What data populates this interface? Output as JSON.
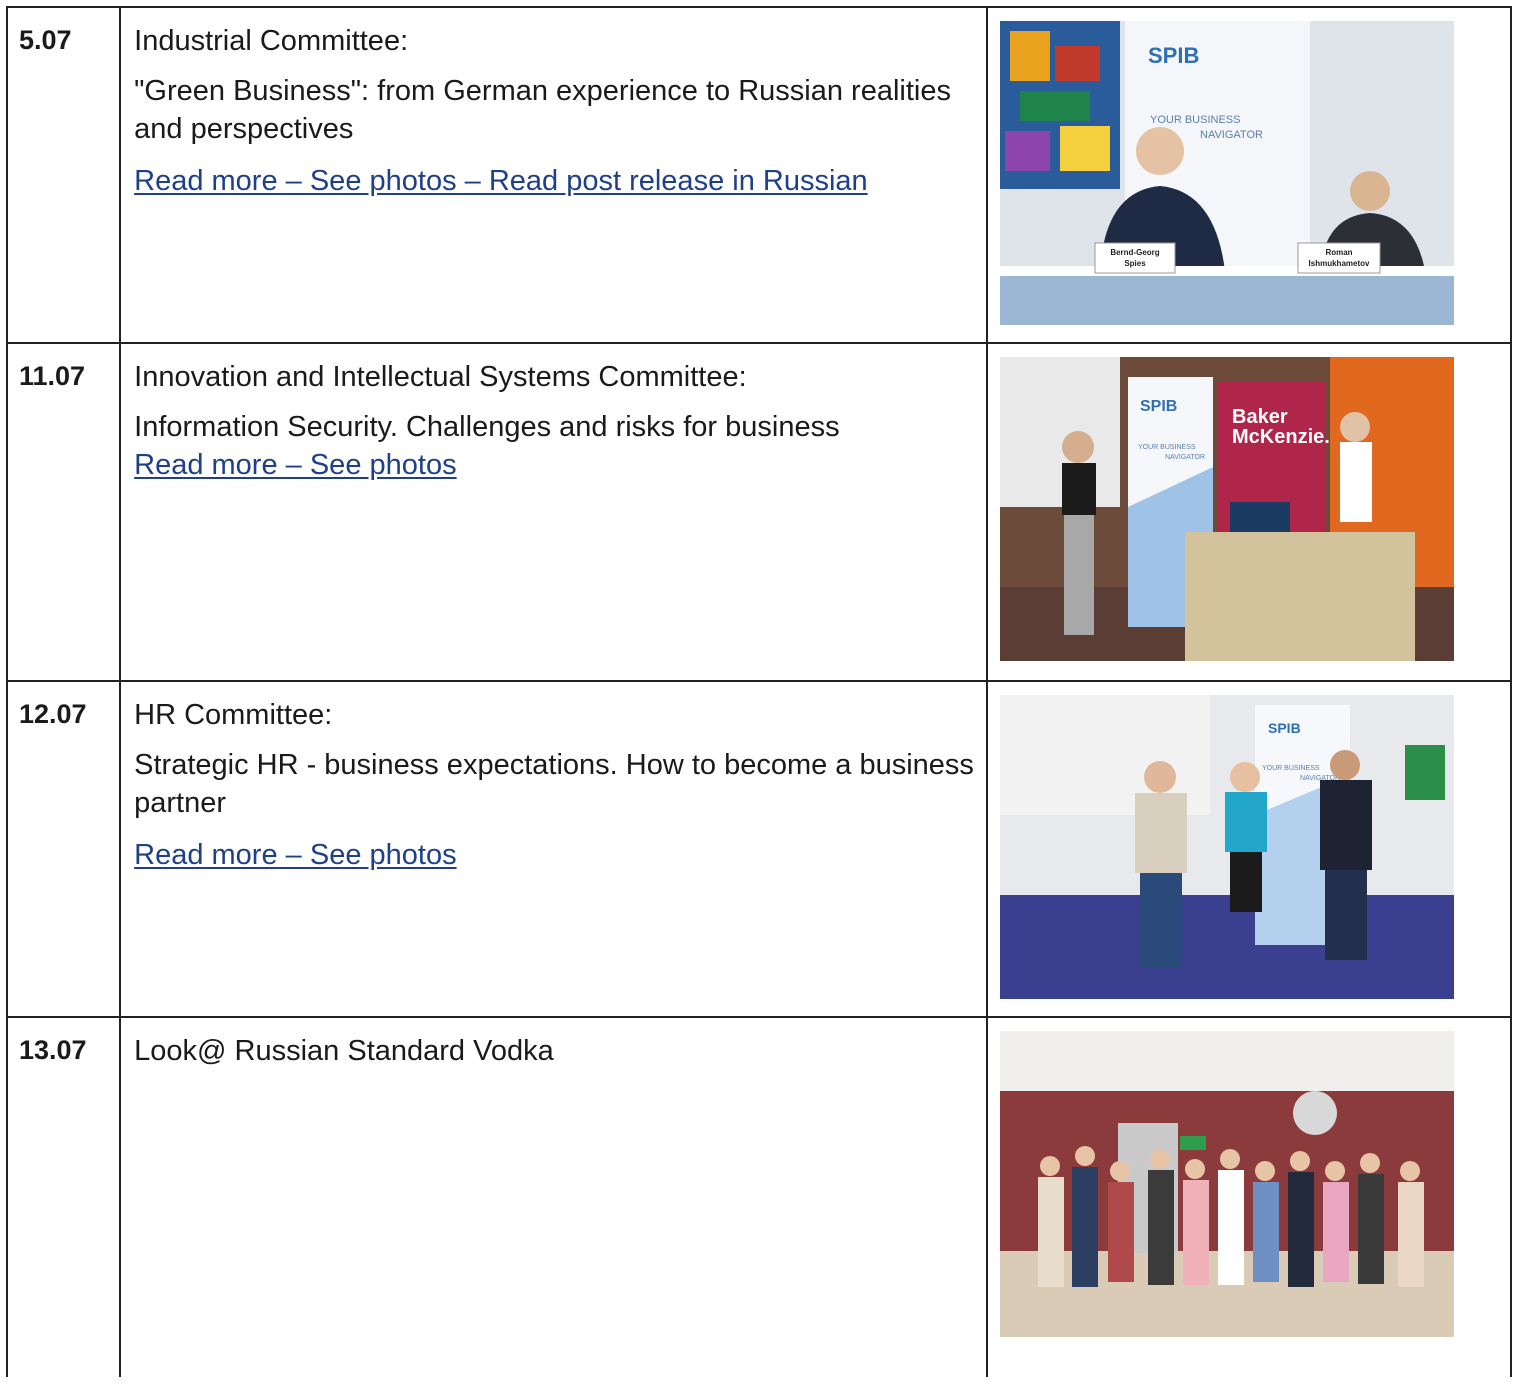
{
  "rows": [
    {
      "date": "5.07",
      "committee": "Industrial Committee:",
      "topic": "\"Green Business\": from German experience to Russian realities and perspectives",
      "links": [
        "Read more ",
        " – See photos",
        " – Read post release in Russian"
      ],
      "photo": {
        "banner_brand": "SPIB",
        "banner_line1": "YOUR BUSINESS",
        "banner_line2": "NAVIGATOR",
        "nameplate1_line1": "Bernd-Georg",
        "nameplate1_line2": "Spies",
        "nameplate2_line1": "Roman",
        "nameplate2_line2": "Ishmukhametov"
      }
    },
    {
      "date": "11.07",
      "committee": "Innovation and Intellectual Systems Committee:",
      "topic": "Information Security. Challenges and risks for business",
      "links": [
        "Read more ",
        " – See photos"
      ],
      "photo": {
        "banner_brand": "SPIB",
        "banner_line1": "YOUR BUSINESS",
        "banner_line2": "NAVIGATOR",
        "sponsor_line1": "Baker",
        "sponsor_line2": "McKenzie."
      }
    },
    {
      "date": "12.07",
      "committee": "HR Committee:",
      "topic": "Strategic HR - business expectations. How to become a business partner",
      "links": [
        "Read more",
        " – See photos"
      ],
      "photo": {
        "banner_brand": "SPIB",
        "banner_line1": "YOUR BUSINESS",
        "banner_line2": "NAVIGATOR"
      }
    },
    {
      "date": "13.07",
      "committee": "Look@ Russian Standard Vodka",
      "photo": {}
    }
  ]
}
